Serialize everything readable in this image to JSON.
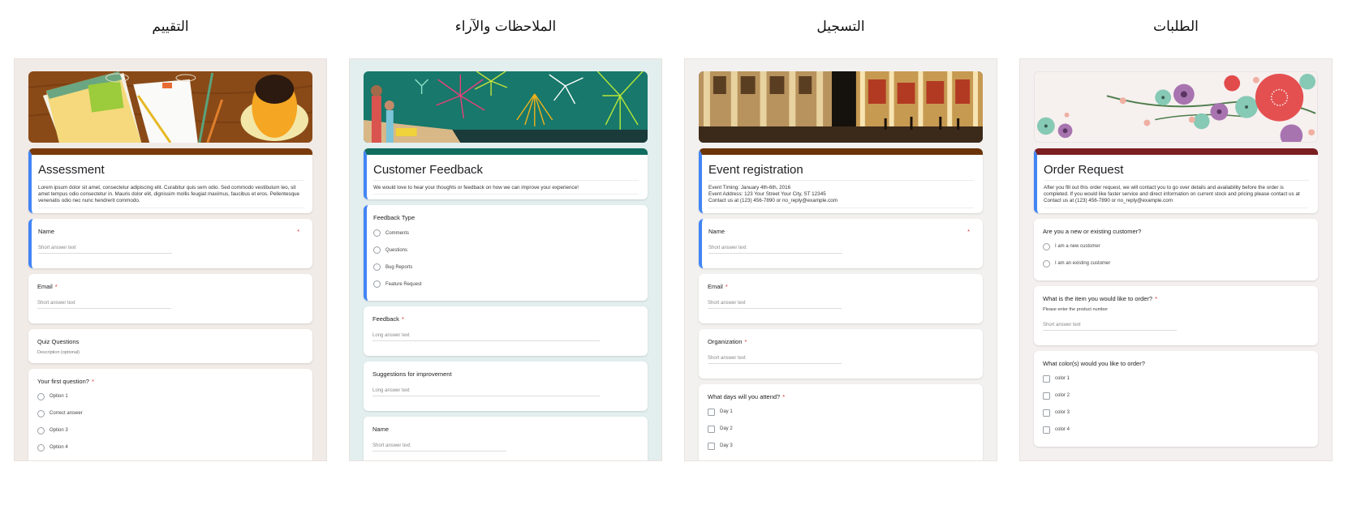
{
  "templates": [
    {
      "category": "التقييم",
      "form": {
        "title": "Assessment",
        "description": "Lorem ipsum dolor sit amet, consectetur adipiscing elit. Curabitur quis sem odio. Sed commodo vestibulum leo, sit amet tempus odio consectetur in. Mauris dolor elit, dignissim mollis feugiat maximus, faucibus et eros. Pellentesque venenatis odio nec nunc hendrerit commodo.",
        "header_color": "#7a3a0b",
        "questions": [
          {
            "label": "Name",
            "required": true,
            "placeholder": "Short answer text"
          },
          {
            "label": "Email",
            "required": true,
            "placeholder": "Short answer text"
          },
          {
            "label": "Quiz Questions",
            "hint": "Description (optional)"
          },
          {
            "label": "Your first question?",
            "required": true,
            "options": [
              "Option 1",
              "Correct answer",
              "Option 3",
              "Option 4"
            ]
          }
        ]
      }
    },
    {
      "category": "الملاحظات والآراء",
      "form": {
        "title": "Customer Feedback",
        "description": "We would love to hear your thoughts or feedback on how we can improve your experience!",
        "header_color": "#0f6c5f",
        "questions": [
          {
            "label": "Feedback Type",
            "options": [
              "Comments",
              "Questions",
              "Bug Reports",
              "Feature Request"
            ]
          },
          {
            "label": "Feedback",
            "required": true,
            "placeholder": "Long answer text"
          },
          {
            "label": "Suggestions for improvement",
            "placeholder": "Long answer text"
          },
          {
            "label": "Name",
            "placeholder": "Short answer text"
          }
        ]
      }
    },
    {
      "category": "التسجيل",
      "form": {
        "title": "Event registration",
        "description_lines": [
          "Event Timing: January 4th-6th, 2016",
          "Event Address: 123 Your Street Your City, ST 12345",
          "Contact us at (123) 456-7890 or no_reply@example.com"
        ],
        "header_color": "#6b3306",
        "questions": [
          {
            "label": "Name",
            "required": true,
            "placeholder": "Short answer text"
          },
          {
            "label": "Email",
            "required": true,
            "placeholder": "Short answer text"
          },
          {
            "label": "Organization",
            "required": true,
            "placeholder": "Short answer text"
          },
          {
            "label": "What days will you attend?",
            "required": true,
            "checkboxes": [
              "Day 1",
              "Day 2",
              "Day 3"
            ]
          }
        ]
      }
    },
    {
      "category": "الطلبات",
      "form": {
        "title": "Order Request",
        "description": "After you fill out this order request, we will contact you to go over details and availability before the order is completed. If you would like faster service and direct information on current stock and pricing please contact us at Contact us at (123) 456-7890 or no_reply@example.com",
        "header_color": "#7b1e22",
        "questions": [
          {
            "label": "Are you a new or existing customer?",
            "options": [
              "I am a new customer",
              "I am an existing customer"
            ]
          },
          {
            "label": "What is the item you would like to order?",
            "required": true,
            "subhint": "Please enter the product number",
            "placeholder": "Short answer text"
          },
          {
            "label": "What color(s) would you like to order?",
            "checkboxes": [
              "color 1",
              "color 2",
              "color 3",
              "color 4"
            ]
          }
        ]
      }
    }
  ],
  "required_marker": "*"
}
